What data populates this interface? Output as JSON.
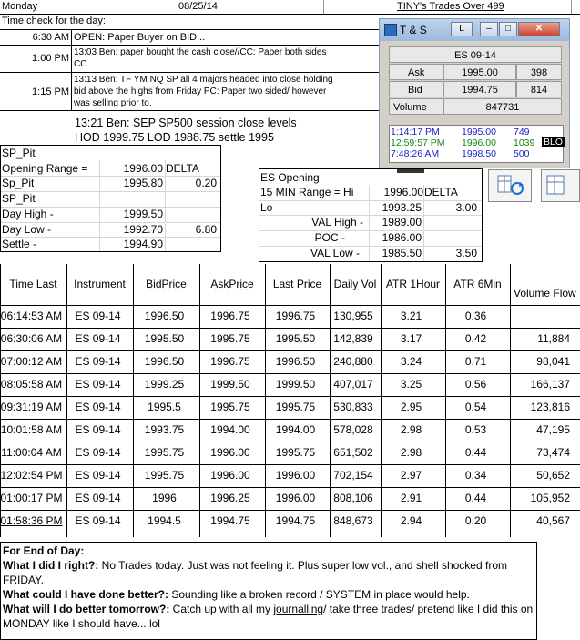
{
  "header": {
    "day": "Monday",
    "date": "08/25/14",
    "title": "TINY's Trades Over 499",
    "time_check_label": "Time check for the day:"
  },
  "log": [
    {
      "time": "6:30 AM",
      "text": "OPEN: Paper Buyer on BID..."
    },
    {
      "time": "1:00 PM",
      "text": "13:03 Ben: paper bought the cash close//CC: Paper both sides CC"
    },
    {
      "time": "1:15 PM",
      "text": "13:13 Ben: TF YM NQ SP all 4 majors headed into close holding bid above the highs from Friday PC: Paper two sided/ however was selling prior to."
    }
  ],
  "close_note": {
    "line1": "13:21 Ben: SEP SP500 session close levels",
    "line2": "HOD 1999.75 LOD 1988.75 settle 1995"
  },
  "sp_pit": {
    "rows": [
      {
        "label": "SP_Pit",
        "value": "",
        "extra": ""
      },
      {
        "label": "Opening Range =",
        "value": "1996.00",
        "extra": "DELTA"
      },
      {
        "label": "Sp_Pit",
        "value": "1995.80",
        "extra": "0.20"
      },
      {
        "label": "SP_Pit",
        "value": "",
        "extra": ""
      },
      {
        "label": "Day High -",
        "value": "1999.50",
        "extra": ""
      },
      {
        "label": "Day Low -",
        "value": "1992.70",
        "extra": "6.80"
      },
      {
        "label": "Settle -",
        "value": "1994.90",
        "extra": ""
      }
    ]
  },
  "es_opening": {
    "title": "ES Opening",
    "rows": [
      {
        "label": "15 MIN Range = Hi",
        "value": "1996.00",
        "extra": "DELTA"
      },
      {
        "label": "Lo",
        "value": "1993.25",
        "extra": "3.00"
      },
      {
        "label": "VAL High  -",
        "value": "1989.00",
        "extra": ""
      },
      {
        "label": "POC  -",
        "value": "1986.00",
        "extra": ""
      },
      {
        "label": "VAL Low  -",
        "value": "1985.50",
        "extra": "3.50"
      }
    ]
  },
  "ts_window": {
    "title": "T & S",
    "title_btn": "L",
    "symbol": "ES 09-14",
    "ask_label": "Ask",
    "ask": "1995.00",
    "ask_size": "398",
    "bid_label": "Bid",
    "bid": "1994.75",
    "bid_size": "814",
    "volume_label": "Volume",
    "volume": "847731",
    "tape": [
      {
        "time": "1:14:17 PM",
        "price": "1995.00",
        "size": "749",
        "tag": "",
        "color": "#1a1acc"
      },
      {
        "time": "12:59:57 PM",
        "price": "1996.00",
        "size": "1039",
        "tag": "BLO",
        "color": "#118811"
      },
      {
        "time": "7:48:26 AM",
        "price": "1998.50",
        "size": "500",
        "tag": "",
        "color": "#1a1acc"
      }
    ]
  },
  "table": {
    "headers": [
      "Time Last",
      "Instrument",
      "BidPrice",
      "AskPrice",
      "Last Price",
      "Daily Vol",
      "ATR 1Hour",
      "ATR 6Min",
      "Volume Flow"
    ],
    "rows": [
      [
        "06:14:53 AM",
        "ES 09-14",
        "1996.50",
        "1996.75",
        "1996.75",
        "130,955",
        "3.21",
        "0.36",
        ""
      ],
      [
        "06:30:06 AM",
        "ES 09-14",
        "1995.50",
        "1995.75",
        "1995.50",
        "142,839",
        "3.17",
        "0.42",
        "11,884"
      ],
      [
        "07:00:12 AM",
        "ES 09-14",
        "1996.50",
        "1996.75",
        "1996.50",
        "240,880",
        "3.24",
        "0.71",
        "98,041"
      ],
      [
        "08:05:58 AM",
        "ES 09-14",
        "1999.25",
        "1999.50",
        "1999.50",
        "407,017",
        "3.25",
        "0.56",
        "166,137"
      ],
      [
        "09:31:19 AM",
        "ES 09-14",
        "1995.5",
        "1995.75",
        "1995.75",
        "530,833",
        "2.95",
        "0.54",
        "123,816"
      ],
      [
        "10:01:58 AM",
        "ES 09-14",
        "1993.75",
        "1994.00",
        "1994.00",
        "578,028",
        "2.98",
        "0.53",
        "47,195"
      ],
      [
        "11:00:04 AM",
        "ES 09-14",
        "1995.75",
        "1996.00",
        "1995.75",
        "651,502",
        "2.98",
        "0.44",
        "73,474"
      ],
      [
        "12:02:54 PM",
        "ES 09-14",
        "1995.75",
        "1996.00",
        "1996.00",
        "702,154",
        "2.97",
        "0.34",
        "50,652"
      ],
      [
        "01:00:17 PM",
        "ES 09-14",
        "1996",
        "1996.25",
        "1996.00",
        "808,106",
        "2.91",
        "0.44",
        "105,952"
      ],
      [
        "01:58:36 PM",
        "ES 09-14",
        "1994.5",
        "1994.75",
        "1994.75",
        "848,673",
        "2.94",
        "0.20",
        "40,567"
      ]
    ]
  },
  "review": {
    "title": "For End of Day:",
    "q1": "What I did I right?:",
    "a1": "No Trades today.  Just was not feeling it.  Plus super low vol., and shell shocked from FRIDAY.",
    "q2": "What could I have done better?:",
    "a2": "Sounding like a broken record / SYSTEM in place would help.",
    "q3": "What will I do better tomorrow?:",
    "a3_pre": "Catch up with all my ",
    "a3_word": "journalling",
    "a3_post": "/ take three trades/ pretend like I did this on MONDAY like I should have... lol"
  }
}
